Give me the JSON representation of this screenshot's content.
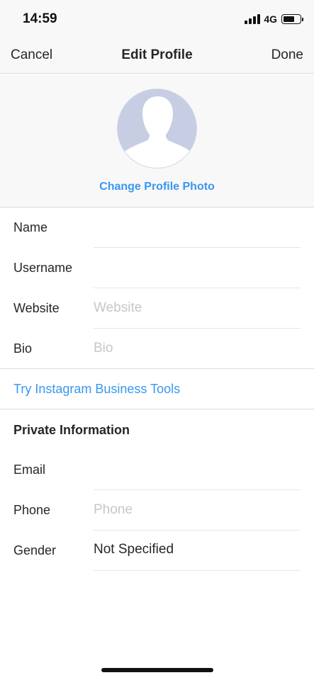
{
  "status": {
    "time": "14:59",
    "network": "4G",
    "signal_icon": "signal-bars-icon",
    "battery_icon": "battery-icon"
  },
  "nav": {
    "cancel_label": "Cancel",
    "title": "Edit Profile",
    "done_label": "Done"
  },
  "profile": {
    "avatar_icon": "default-avatar-icon",
    "change_photo_label": "Change Profile Photo"
  },
  "fields": {
    "name": {
      "label": "Name",
      "value": "",
      "placeholder": ""
    },
    "username": {
      "label": "Username",
      "value": "",
      "placeholder": ""
    },
    "website": {
      "label": "Website",
      "value": "",
      "placeholder": "Website"
    },
    "bio": {
      "label": "Bio",
      "value": "",
      "placeholder": "Bio"
    }
  },
  "business_tools_label": "Try Instagram Business Tools",
  "private": {
    "heading": "Private Information",
    "email": {
      "label": "Email",
      "value": "",
      "placeholder": ""
    },
    "phone": {
      "label": "Phone",
      "value": "",
      "placeholder": "Phone"
    },
    "gender": {
      "label": "Gender",
      "value": "Not Specified"
    }
  },
  "colors": {
    "accent": "#3897f0",
    "text": "#262626",
    "placeholder": "#c7c7c7",
    "header_bg": "#f8f8f8",
    "avatar_bg": "#c7cde3"
  }
}
